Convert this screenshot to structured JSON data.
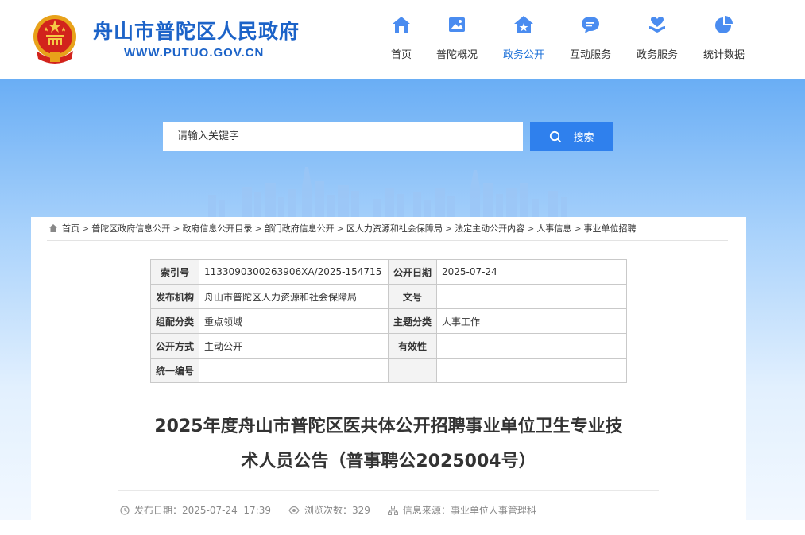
{
  "header": {
    "site_title": "舟山市普陀区人民政府",
    "site_url": "WWW.PUTUO.GOV.CN",
    "nav": [
      {
        "label": "首页",
        "icon": "home-icon",
        "active": false
      },
      {
        "label": "普陀概况",
        "icon": "image-icon",
        "active": false
      },
      {
        "label": "政务公开",
        "icon": "house-star-icon",
        "active": true
      },
      {
        "label": "互动服务",
        "icon": "chat-bubble-icon",
        "active": false
      },
      {
        "label": "政务服务",
        "icon": "heart-hand-icon",
        "active": false
      },
      {
        "label": "统计数据",
        "icon": "pie-chart-icon",
        "active": false
      }
    ],
    "colors": {
      "brand": "#1c63c8",
      "accent": "#4a8cf0"
    }
  },
  "search": {
    "placeholder": "请输入关键字",
    "button_label": "搜索"
  },
  "breadcrumb": [
    "首页",
    "普陀区政府信息公开",
    "政府信息公开目录",
    "部门政府信息公开",
    "区人力资源和社会保障局",
    "法定主动公开内容",
    "人事信息",
    "事业单位招聘"
  ],
  "meta_table": {
    "index_label": "索引号",
    "index_value": "1133090300263906XA/2025-154715",
    "pubdate_label": "公开日期",
    "pubdate_value": "2025-07-24",
    "issuer_label": "发布机构",
    "issuer_value": "舟山市普陀区人力资源和社会保障局",
    "docno_label": "文号",
    "docno_value": "",
    "category_label": "组配分类",
    "category_value": "重点领域",
    "topic_label": "主题分类",
    "topic_value": "人事工作",
    "mode_label": "公开方式",
    "mode_value": "主动公开",
    "validity_label": "有效性",
    "validity_value": "",
    "serial_label": "统一编号",
    "serial_value": ""
  },
  "article": {
    "title_line1": "2025年度舟山市普陀区医共体公开招聘事业单位卫生专业技",
    "title_line2": "术人员公告（普事聘公2025004号）",
    "publish_label": "发布日期：",
    "publish_value": "2025-07-24  17:39",
    "views_label": "浏览次数：",
    "views_value": "329",
    "source_label": "信息来源：",
    "source_value": "事业单位人事管理科"
  }
}
